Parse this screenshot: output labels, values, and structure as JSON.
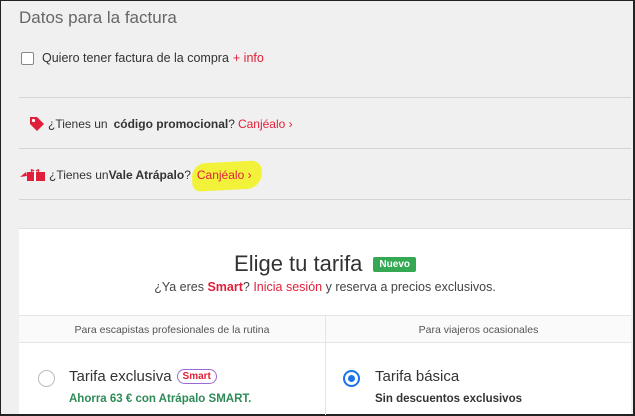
{
  "invoice": {
    "title": "Datos para la factura",
    "checkbox_label": "Quiero tener factura de la compra",
    "more_info": "+ info"
  },
  "promo": {
    "prefix": "¿Tienes un",
    "bold": "código promocional",
    "suffix": "?",
    "link": "Canjéalo ›"
  },
  "vale": {
    "prefix": "¿Tienes un ",
    "bold": "Vale Atrápalo",
    "suffix": "?",
    "link": "Canjéalo ›"
  },
  "tariff": {
    "title": "Elige tu tarifa",
    "badge": "Nuevo",
    "subtitle_prefix": "¿Ya eres ",
    "smart": "Smart",
    "subtitle_mid": "? ",
    "login": "Inicia sesión",
    "subtitle_suffix": " y reserva a precios exclusivos.",
    "columns": [
      {
        "header": "Para escapistas profesionales de la rutina",
        "plan_name": "Tarifa exclusiva",
        "plan_badge": "Smart",
        "plan_sub": "Ahorra 63 € con Atrápalo SMART.",
        "selected": false
      },
      {
        "header": "Para viajeros ocasionales",
        "plan_name": "Tarifa básica",
        "plan_badge": "",
        "plan_sub": "Sin descuentos exclusivos",
        "selected": true
      }
    ]
  },
  "colors": {
    "accent_red": "#e0203a",
    "badge_green": "#34a853",
    "radio_blue": "#1a73e8",
    "highlight_yellow": "#f2f23a"
  },
  "icons": {
    "promo": "price-tag-icon",
    "vale": "gift-voucher-icon"
  }
}
